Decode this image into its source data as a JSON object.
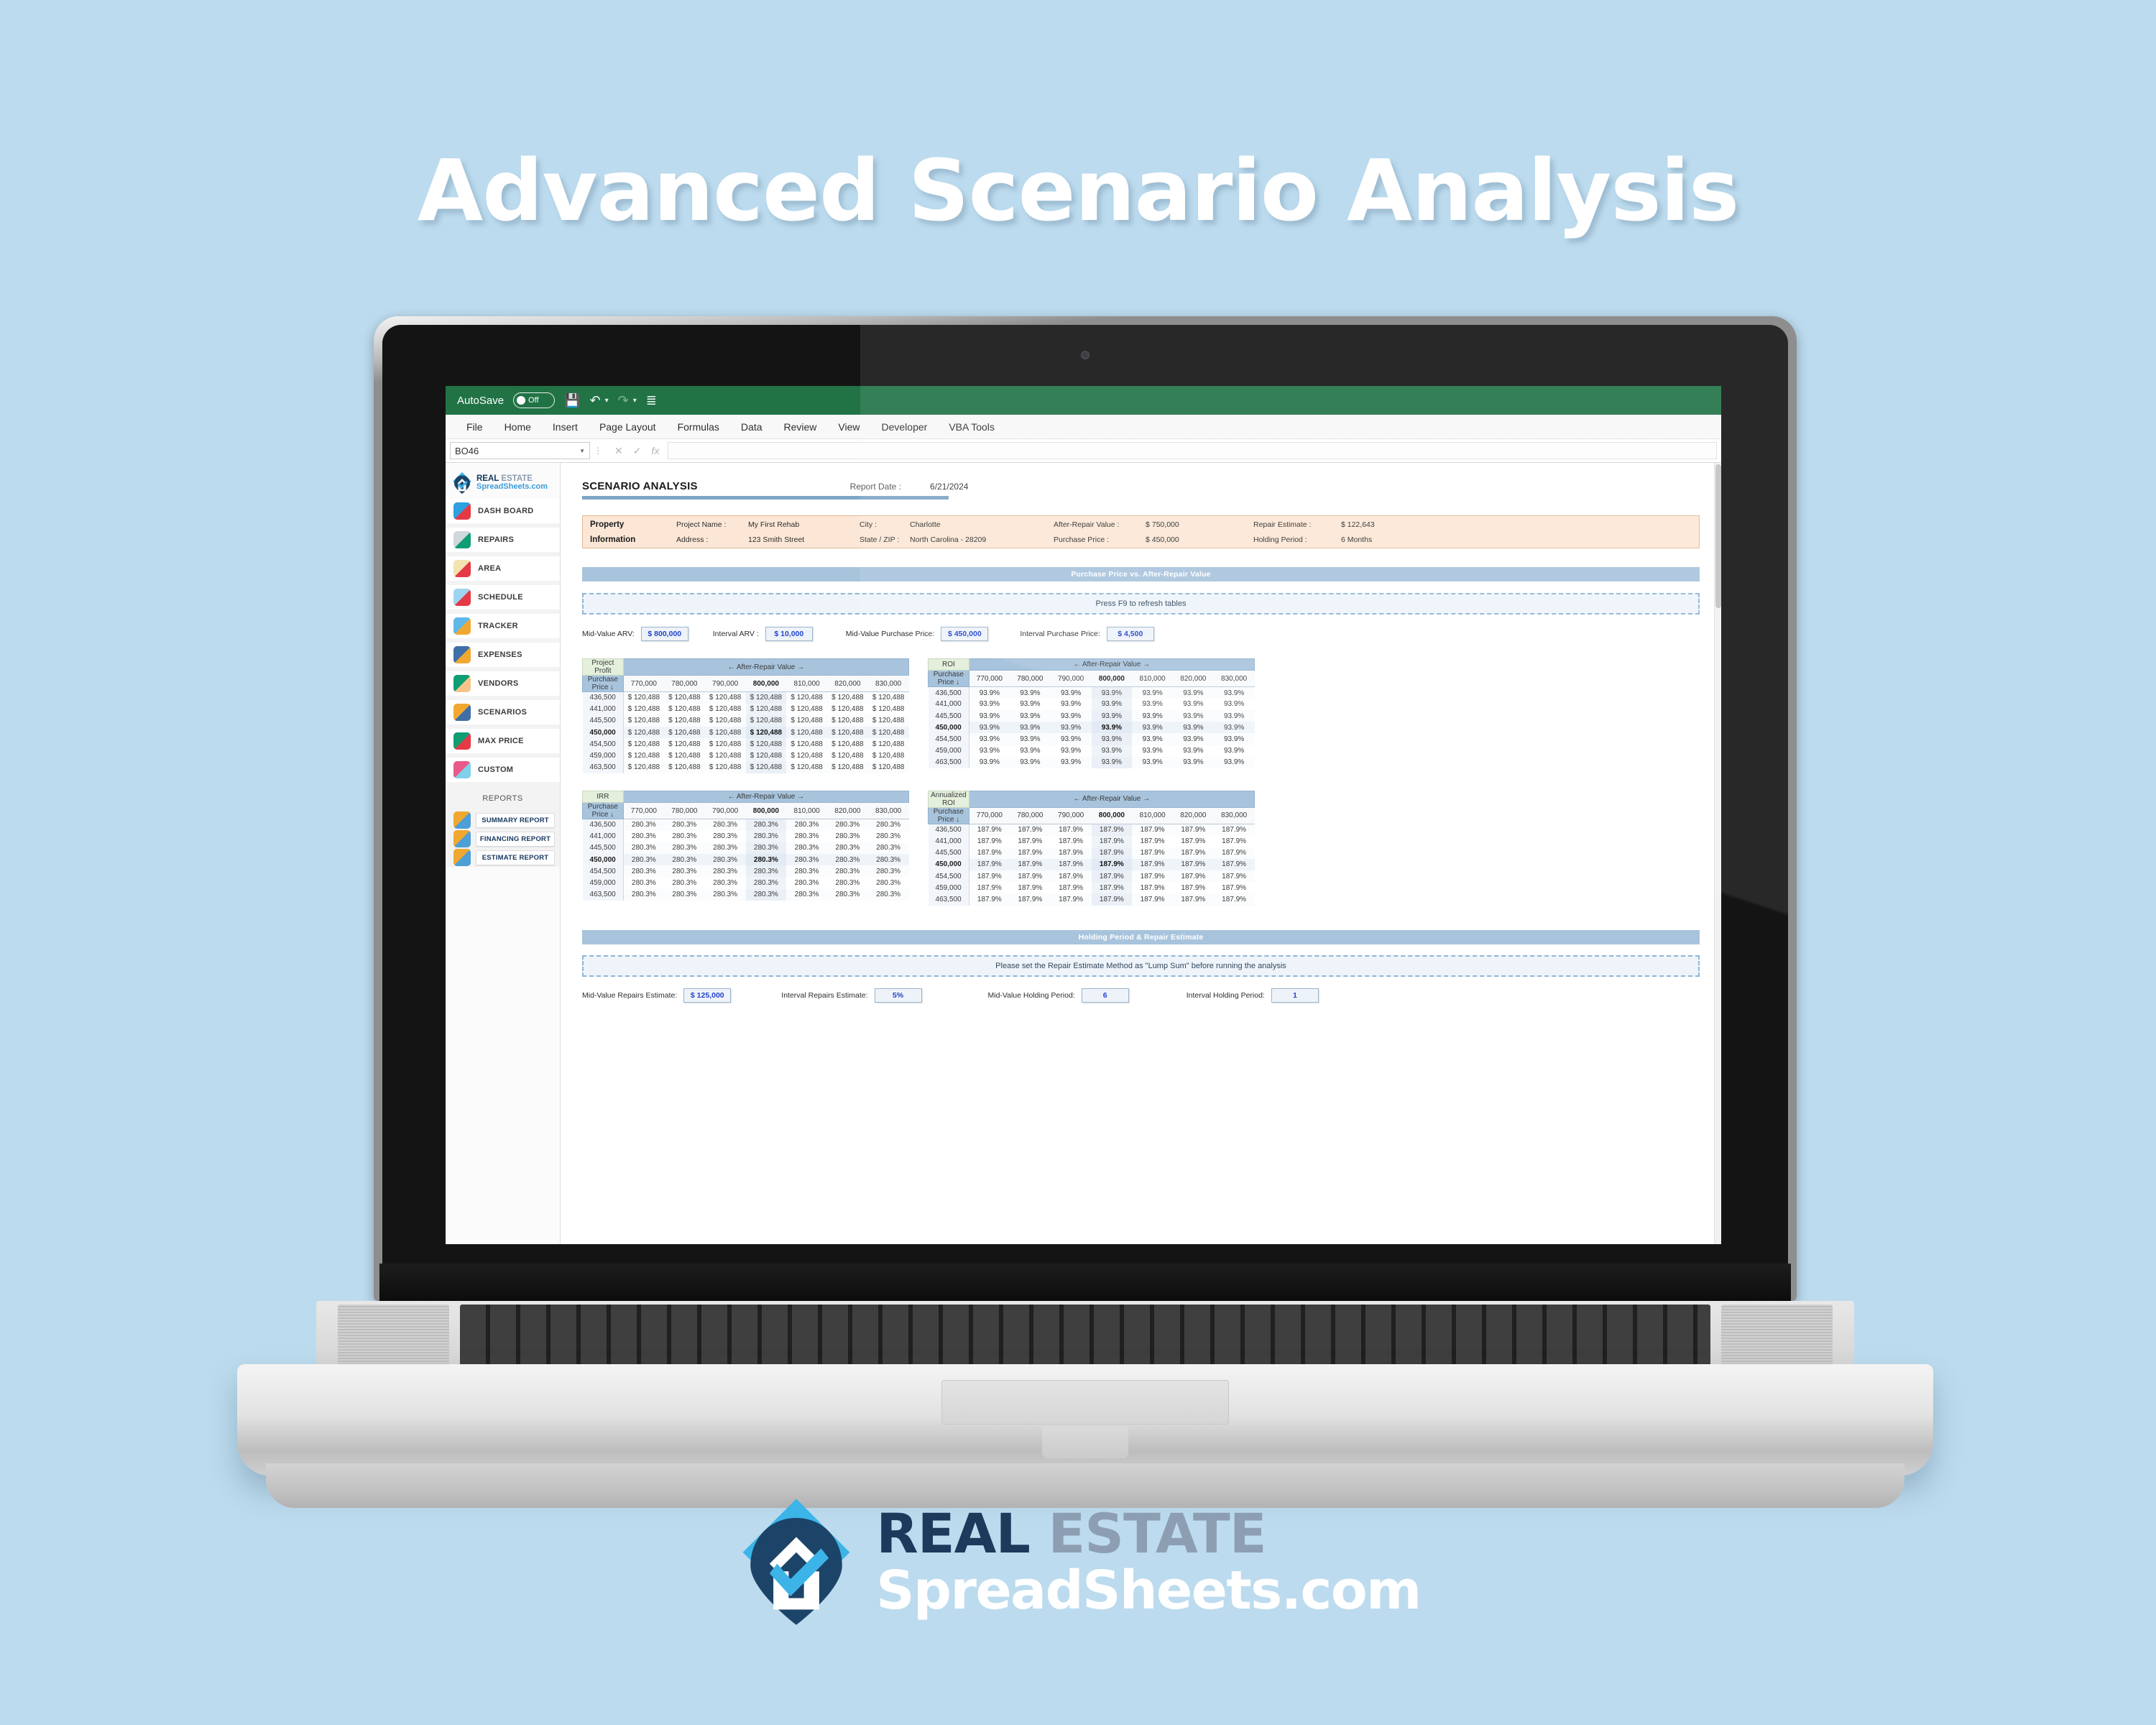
{
  "hero": {
    "title": "Advanced Scenario Analysis"
  },
  "excel": {
    "titlebar": {
      "autosave_label": "AutoSave",
      "autosave_state": "Off",
      "save_icon": "save-icon",
      "undo_icon": "undo-icon",
      "redo_icon": "redo-icon",
      "more_icon": "customize-quick-access-icon"
    },
    "ribbon_tabs": [
      "File",
      "Home",
      "Insert",
      "Page Layout",
      "Formulas",
      "Data",
      "Review",
      "View",
      "Developer",
      "VBA Tools"
    ],
    "formula_bar": {
      "name_box_value": "BO46",
      "cancel_icon": "cancel-icon",
      "enter_icon": "check-icon",
      "fx_icon": "function-icon",
      "formula_value": "",
      "formula_placeholder": ""
    }
  },
  "sidebar": {
    "logo": {
      "line1_dark": "REAL",
      "line1_light": "ESTATE",
      "line2": "SpreadSheets.com"
    },
    "items": [
      {
        "label": "DASH BOARD",
        "icon": "dashboard-house-icon",
        "color1": "#2e9fe0",
        "color2": "#e63946"
      },
      {
        "label": "REPAIRS",
        "icon": "repairs-wrench-icon",
        "color1": "#cfd8dc",
        "color2": "#0f9d73"
      },
      {
        "label": "AREA",
        "icon": "area-map-pin-icon",
        "color1": "#f2e3b0",
        "color2": "#e63946"
      },
      {
        "label": "SCHEDULE",
        "icon": "schedule-calendar-icon",
        "color1": "#9fd4f0",
        "color2": "#e63946"
      },
      {
        "label": "TRACKER",
        "icon": "tracker-chart-icon",
        "color1": "#5fb8e8",
        "color2": "#f0a830"
      },
      {
        "label": "EXPENSES",
        "icon": "expenses-monitor-icon",
        "color1": "#3f6fa8",
        "color2": "#f0a830"
      },
      {
        "label": "VENDORS",
        "icon": "vendors-agent-icon",
        "color1": "#0f9d73",
        "color2": "#f6c48a"
      },
      {
        "label": "SCENARIOS",
        "icon": "scenarios-list-icon",
        "color1": "#f0a830",
        "color2": "#3f6fa8"
      },
      {
        "label": "MAX PRICE",
        "icon": "max-price-target-icon",
        "color1": "#0f9d73",
        "color2": "#e63946"
      },
      {
        "label": "CUSTOM",
        "icon": "custom-page-icon",
        "color1": "#e85a8a",
        "color2": "#7fd0e8"
      }
    ],
    "reports_heading": "REPORTS",
    "reports": [
      {
        "label": "SUMMARY REPORT",
        "icon": "summary-report-icon"
      },
      {
        "label": "FINANCING REPORT",
        "icon": "financing-report-icon"
      },
      {
        "label": "ESTIMATE REPORT",
        "icon": "estimate-report-icon"
      }
    ]
  },
  "sheet": {
    "page_title": "SCENARIO ANALYSIS",
    "report_date_label": "Report Date :",
    "report_date_value": "6/21/2024",
    "property_info": {
      "title_line1": "Property",
      "title_line2": "Information",
      "row1": [
        {
          "label": "Project Name :",
          "value": "My First Rehab"
        },
        {
          "label": "City :",
          "value": "Charlotte"
        },
        {
          "label": "After-Repair Value :",
          "value": "$ 750,000"
        },
        {
          "label": "Repair Estimate :",
          "value": "$ 122,643"
        }
      ],
      "row2": [
        {
          "label": "Address :",
          "value": "123 Smith Street"
        },
        {
          "label": "State / ZIP :",
          "value": "North Carolina - 28209"
        },
        {
          "label": "Purchase Price :",
          "value": "$ 450,000"
        },
        {
          "label": "Holding Period :",
          "value": "6 Months"
        }
      ]
    },
    "section1": {
      "band": "Purchase Price vs. After-Repair Value",
      "notice": "Press F9 to refresh tables",
      "inputs": [
        {
          "label": "Mid-Value ARV:",
          "value": "$ 800,000"
        },
        {
          "label": "Interval ARV :",
          "value": "$ 10,000"
        },
        {
          "label": "Mid-Value Purchase Price:",
          "value": "$ 450,000"
        },
        {
          "label": "Interval Purchase Price:",
          "value": "$ 4,500"
        }
      ]
    },
    "section2": {
      "band": "Holding Period & Repair Estimate",
      "notice": "Please set the Repair Estimate Method as \"Lump Sum\" before running the analysis",
      "inputs": [
        {
          "label": "Mid-Value Repairs Estimate:",
          "value": "$ 125,000"
        },
        {
          "label": "Interval Repairs Estimate:",
          "value": "5%"
        },
        {
          "label": "Mid-Value Holding Period:",
          "value": "6"
        },
        {
          "label": "Interval Holding Period:",
          "value": "1"
        }
      ]
    }
  },
  "chart_data": [
    {
      "type": "table",
      "title": "Project Profit",
      "xlabel": "← After-Repair Value →",
      "ylabel": "Purchase Price ↓",
      "categories": [
        "770,000",
        "780,000",
        "790,000",
        "800,000",
        "810,000",
        "820,000",
        "830,000"
      ],
      "highlight_column_index": 3,
      "highlight_row_index": 3,
      "rows": [
        {
          "label": "436,500",
          "values": [
            "$ 120,488",
            "$ 120,488",
            "$ 120,488",
            "$ 120,488",
            "$ 120,488",
            "$ 120,488",
            "$ 120,488"
          ]
        },
        {
          "label": "441,000",
          "values": [
            "$ 120,488",
            "$ 120,488",
            "$ 120,488",
            "$ 120,488",
            "$ 120,488",
            "$ 120,488",
            "$ 120,488"
          ]
        },
        {
          "label": "445,500",
          "values": [
            "$ 120,488",
            "$ 120,488",
            "$ 120,488",
            "$ 120,488",
            "$ 120,488",
            "$ 120,488",
            "$ 120,488"
          ]
        },
        {
          "label": "450,000",
          "values": [
            "$ 120,488",
            "$ 120,488",
            "$ 120,488",
            "$ 120,488",
            "$ 120,488",
            "$ 120,488",
            "$ 120,488"
          ]
        },
        {
          "label": "454,500",
          "values": [
            "$ 120,488",
            "$ 120,488",
            "$ 120,488",
            "$ 120,488",
            "$ 120,488",
            "$ 120,488",
            "$ 120,488"
          ]
        },
        {
          "label": "459,000",
          "values": [
            "$ 120,488",
            "$ 120,488",
            "$ 120,488",
            "$ 120,488",
            "$ 120,488",
            "$ 120,488",
            "$ 120,488"
          ]
        },
        {
          "label": "463,500",
          "values": [
            "$ 120,488",
            "$ 120,488",
            "$ 120,488",
            "$ 120,488",
            "$ 120,488",
            "$ 120,488",
            "$ 120,488"
          ]
        }
      ]
    },
    {
      "type": "table",
      "title": "ROI",
      "xlabel": "← After-Repair Value →",
      "ylabel": "Purchase Price ↓",
      "categories": [
        "770,000",
        "780,000",
        "790,000",
        "800,000",
        "810,000",
        "820,000",
        "830,000"
      ],
      "highlight_column_index": 3,
      "highlight_row_index": 3,
      "rows": [
        {
          "label": "436,500",
          "values": [
            "93.9%",
            "93.9%",
            "93.9%",
            "93.9%",
            "93.9%",
            "93.9%",
            "93.9%"
          ]
        },
        {
          "label": "441,000",
          "values": [
            "93.9%",
            "93.9%",
            "93.9%",
            "93.9%",
            "93.9%",
            "93.9%",
            "93.9%"
          ]
        },
        {
          "label": "445,500",
          "values": [
            "93.9%",
            "93.9%",
            "93.9%",
            "93.9%",
            "93.9%",
            "93.9%",
            "93.9%"
          ]
        },
        {
          "label": "450,000",
          "values": [
            "93.9%",
            "93.9%",
            "93.9%",
            "93.9%",
            "93.9%",
            "93.9%",
            "93.9%"
          ]
        },
        {
          "label": "454,500",
          "values": [
            "93.9%",
            "93.9%",
            "93.9%",
            "93.9%",
            "93.9%",
            "93.9%",
            "93.9%"
          ]
        },
        {
          "label": "459,000",
          "values": [
            "93.9%",
            "93.9%",
            "93.9%",
            "93.9%",
            "93.9%",
            "93.9%",
            "93.9%"
          ]
        },
        {
          "label": "463,500",
          "values": [
            "93.9%",
            "93.9%",
            "93.9%",
            "93.9%",
            "93.9%",
            "93.9%",
            "93.9%"
          ]
        }
      ]
    },
    {
      "type": "table",
      "title": "IRR",
      "xlabel": "← After-Repair Value →",
      "ylabel": "Purchase Price ↓",
      "categories": [
        "770,000",
        "780,000",
        "790,000",
        "800,000",
        "810,000",
        "820,000",
        "830,000"
      ],
      "highlight_column_index": 3,
      "highlight_row_index": 3,
      "rows": [
        {
          "label": "436,500",
          "values": [
            "280.3%",
            "280.3%",
            "280.3%",
            "280.3%",
            "280.3%",
            "280.3%",
            "280.3%"
          ]
        },
        {
          "label": "441,000",
          "values": [
            "280.3%",
            "280.3%",
            "280.3%",
            "280.3%",
            "280.3%",
            "280.3%",
            "280.3%"
          ]
        },
        {
          "label": "445,500",
          "values": [
            "280.3%",
            "280.3%",
            "280.3%",
            "280.3%",
            "280.3%",
            "280.3%",
            "280.3%"
          ]
        },
        {
          "label": "450,000",
          "values": [
            "280.3%",
            "280.3%",
            "280.3%",
            "280.3%",
            "280.3%",
            "280.3%",
            "280.3%"
          ]
        },
        {
          "label": "454,500",
          "values": [
            "280.3%",
            "280.3%",
            "280.3%",
            "280.3%",
            "280.3%",
            "280.3%",
            "280.3%"
          ]
        },
        {
          "label": "459,000",
          "values": [
            "280.3%",
            "280.3%",
            "280.3%",
            "280.3%",
            "280.3%",
            "280.3%",
            "280.3%"
          ]
        },
        {
          "label": "463,500",
          "values": [
            "280.3%",
            "280.3%",
            "280.3%",
            "280.3%",
            "280.3%",
            "280.3%",
            "280.3%"
          ]
        }
      ]
    },
    {
      "type": "table",
      "title": "Annualized ROI",
      "xlabel": "← After-Repair Value →",
      "ylabel": "Purchase Price ↓",
      "categories": [
        "770,000",
        "780,000",
        "790,000",
        "800,000",
        "810,000",
        "820,000",
        "830,000"
      ],
      "highlight_column_index": 3,
      "highlight_row_index": 3,
      "rows": [
        {
          "label": "436,500",
          "values": [
            "187.9%",
            "187.9%",
            "187.9%",
            "187.9%",
            "187.9%",
            "187.9%",
            "187.9%"
          ]
        },
        {
          "label": "441,000",
          "values": [
            "187.9%",
            "187.9%",
            "187.9%",
            "187.9%",
            "187.9%",
            "187.9%",
            "187.9%"
          ]
        },
        {
          "label": "445,500",
          "values": [
            "187.9%",
            "187.9%",
            "187.9%",
            "187.9%",
            "187.9%",
            "187.9%",
            "187.9%"
          ]
        },
        {
          "label": "450,000",
          "values": [
            "187.9%",
            "187.9%",
            "187.9%",
            "187.9%",
            "187.9%",
            "187.9%",
            "187.9%"
          ]
        },
        {
          "label": "454,500",
          "values": [
            "187.9%",
            "187.9%",
            "187.9%",
            "187.9%",
            "187.9%",
            "187.9%",
            "187.9%"
          ]
        },
        {
          "label": "459,000",
          "values": [
            "187.9%",
            "187.9%",
            "187.9%",
            "187.9%",
            "187.9%",
            "187.9%",
            "187.9%"
          ]
        },
        {
          "label": "463,500",
          "values": [
            "187.9%",
            "187.9%",
            "187.9%",
            "187.9%",
            "187.9%",
            "187.9%",
            "187.9%"
          ]
        }
      ]
    }
  ],
  "footer_logo": {
    "line1_dark": "REAL",
    "line1_light": "ESTATE",
    "line2": "SpreadSheets.com"
  },
  "colors": {
    "background": "#bcdbee",
    "excel_green": "#217346",
    "band_blue": "#a8c4dd",
    "accent_green": "#17a24a",
    "input_blue": "#2244cc",
    "property_peach": "#fce7d6"
  }
}
